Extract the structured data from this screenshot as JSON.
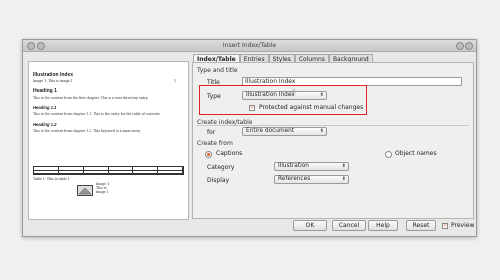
{
  "window": {
    "title": "Insert Index/Table"
  },
  "preview": {
    "title": "Illustration Index",
    "entry": "Image 1: This is image 1",
    "entry_page": "1",
    "heading1": "Heading 1",
    "heading1_text": "This is the content from the first chapter. This is a user directory entry.",
    "heading11": "Heading 1.1",
    "heading11_text": "This is the content from chapter 1.1. This is the entry for the table of contents.",
    "heading12": "Heading 1.2",
    "heading12_text": "This is the content from chapter 1.2. This keyword is a main entry.",
    "table_caption": "Table 1: This is table 1",
    "image_caption_1": "Image 1:",
    "image_caption_2": "This is",
    "image_caption_3": "image 1"
  },
  "tabs": [
    "Index/Table",
    "Entries",
    "Styles",
    "Columns",
    "Background"
  ],
  "type_and_title": {
    "section": "Type and title",
    "title_label": "Title",
    "title_value": "Illustration Index",
    "type_label": "Type",
    "type_value": "Illustration Index",
    "protected_label": "Protected against manual changes",
    "protected_checked": true
  },
  "create_index": {
    "section": "Create index/table",
    "for_label": "for",
    "for_value": "Entire document"
  },
  "create_from": {
    "section": "Create from",
    "captions_label": "Captions",
    "object_names_label": "Object names",
    "category_label": "Category",
    "category_value": "Illustration",
    "display_label": "Display",
    "display_value": "References"
  },
  "buttons": {
    "ok": "OK",
    "cancel": "Cancel",
    "help": "Help",
    "reset": "Reset",
    "preview": "Preview"
  },
  "colors": {
    "accent": "#e05a1c",
    "highlight": "#e0202a"
  }
}
